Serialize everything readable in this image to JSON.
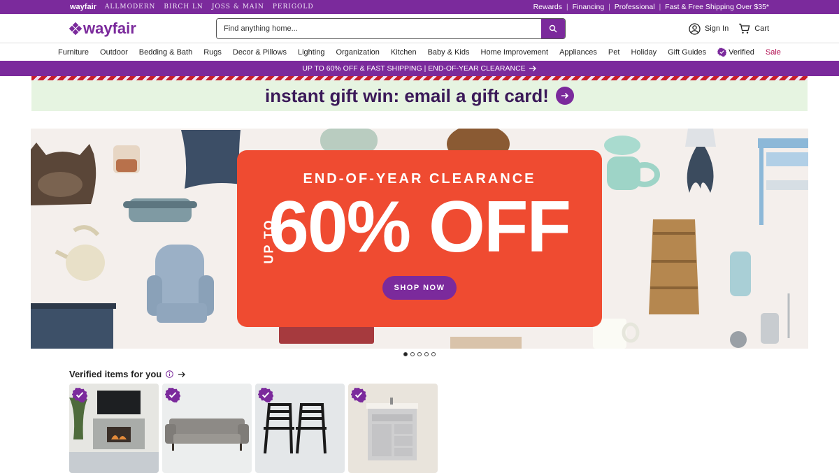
{
  "topbar": {
    "brands": [
      "wayfair",
      "ALLMODERN",
      "BIRCH LN",
      "JOSS & MAIN",
      "PERIGOLD"
    ],
    "links": [
      "Rewards",
      "Financing",
      "Professional",
      "Fast & Free Shipping Over $35*"
    ]
  },
  "header": {
    "logo_text": "wayfair",
    "search_placeholder": "Find anything home...",
    "sign_in": "Sign In",
    "cart": "Cart"
  },
  "nav": {
    "items": [
      "Furniture",
      "Outdoor",
      "Bedding & Bath",
      "Rugs",
      "Decor & Pillows",
      "Lighting",
      "Organization",
      "Kitchen",
      "Baby & Kids",
      "Home Improvement",
      "Appliances",
      "Pet",
      "Holiday",
      "Gift Guides"
    ],
    "verified": "Verified",
    "sale": "Sale"
  },
  "promo_bar": "UP TO 60% OFF & FAST SHIPPING | END-OF-YEAR CLEARANCE",
  "gift_banner": "instant gift win: email a gift card!",
  "hero": {
    "eyebrow": "END-OF-YEAR CLEARANCE",
    "upto": "UP TO",
    "headline": "60% OFF",
    "cta": "SHOP NOW",
    "slides_total": 5,
    "active_slide": 1
  },
  "verified_section": {
    "title": "Verified items for you"
  },
  "colors": {
    "brand_purple": "#7b2a9c",
    "hero_card": "#ef4b31",
    "gift_bg": "#e6f4e1",
    "sale": "#b0094d"
  }
}
